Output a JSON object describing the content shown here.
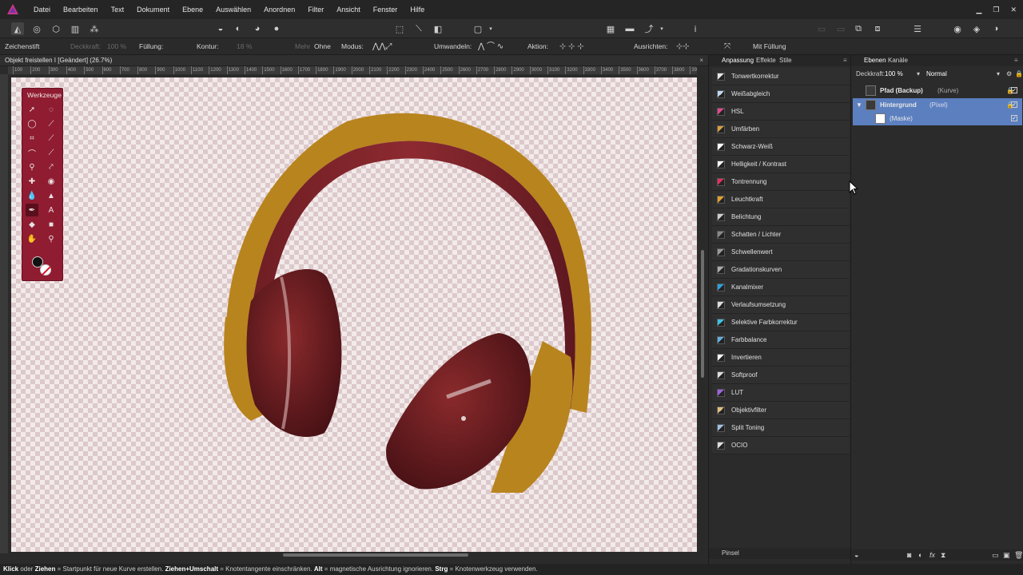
{
  "menubar": {
    "items": [
      "Datei",
      "Bearbeiten",
      "Text",
      "Dokument",
      "Ebene",
      "Auswählen",
      "Anordnen",
      "Filter",
      "Ansicht",
      "Fenster",
      "Hilfe"
    ],
    "brand_color": "#c23a8c"
  },
  "contextbar": {
    "tool_name": "Zeichenstift",
    "opacity_label": "Deckkraft:",
    "opacity_value": "100 %",
    "fill_label": "Füllung:",
    "stroke_label": "Kontur:",
    "stroke_width": "18 %",
    "more_label": "Mehr",
    "none_label": "Ohne",
    "mode_label": "Modus:",
    "convert_label": "Umwandeln:",
    "action_label": "Aktion:",
    "align_label": "Ausrichten:",
    "fill_check_label": "Mit Füllung"
  },
  "document": {
    "tab_title": "Objekt freistellen I [Geändert] (26.7%)",
    "close": "×"
  },
  "ruler": {
    "ticks": [
      "100",
      "200",
      "300",
      "400",
      "500",
      "600",
      "700",
      "800",
      "900",
      "1000",
      "1100",
      "1200",
      "1300",
      "1400",
      "1500",
      "1600",
      "1700",
      "1800",
      "1900",
      "2000",
      "2100",
      "2200",
      "2300",
      "2400",
      "2500",
      "2600",
      "2700",
      "2800",
      "2900",
      "3000",
      "3100",
      "3200",
      "3300",
      "3400",
      "3500",
      "3600",
      "3700",
      "3800",
      "3900"
    ]
  },
  "tools": {
    "title": "Werkzeuge",
    "accent_color": "#8f1c31"
  },
  "adjustments": {
    "tabs": [
      "Anpassung",
      "Effekte",
      "Stile"
    ],
    "items": [
      {
        "label": "Tonwertkorrektur",
        "icon": "levels-icon",
        "color": "#e8e8e8"
      },
      {
        "label": "Weißabgleich",
        "icon": "white-balance-icon",
        "color": "#c0d8f0"
      },
      {
        "label": "HSL",
        "icon": "hsl-icon",
        "color": "#e04a8a"
      },
      {
        "label": "Umfärben",
        "icon": "recolor-icon",
        "color": "#d8a040"
      },
      {
        "label": "Schwarz-Weiß",
        "icon": "black-white-icon",
        "color": "#ffffff"
      },
      {
        "label": "Helligkeit / Kontrast",
        "icon": "brightness-contrast-icon",
        "color": "#ffffff"
      },
      {
        "label": "Tontrennung",
        "icon": "posterize-icon",
        "color": "#e03060"
      },
      {
        "label": "Leuchtkraft",
        "icon": "vibrance-icon",
        "color": "#e0a030"
      },
      {
        "label": "Belichtung",
        "icon": "exposure-icon",
        "color": "#cccccc"
      },
      {
        "label": "Schatten / Lichter",
        "icon": "shadows-highlights-icon",
        "color": "#888888"
      },
      {
        "label": "Schwellenwert",
        "icon": "threshold-icon",
        "color": "#999999"
      },
      {
        "label": "Gradationskurven",
        "icon": "curves-icon",
        "color": "#aaaaaa"
      },
      {
        "label": "Kanalmixer",
        "icon": "channel-mixer-icon",
        "color": "#30a0e0"
      },
      {
        "label": "Verlaufsumsetzung",
        "icon": "gradient-map-icon",
        "color": "#dddddd"
      },
      {
        "label": "Selektive Farbkorrektur",
        "icon": "selective-color-icon",
        "color": "#40c0e0"
      },
      {
        "label": "Farbbalance",
        "icon": "color-balance-icon",
        "color": "#60b0e0"
      },
      {
        "label": "Invertieren",
        "icon": "invert-icon",
        "color": "#ffffff"
      },
      {
        "label": "Softproof",
        "icon": "soft-proof-icon",
        "color": "#dddddd"
      },
      {
        "label": "LUT",
        "icon": "lut-icon",
        "color": "#a060e0"
      },
      {
        "label": "Objektivfilter",
        "icon": "lens-filter-icon",
        "color": "#e0c080"
      },
      {
        "label": "Split Toning",
        "icon": "split-toning-icon",
        "color": "#a0c0e0"
      },
      {
        "label": "OCIO",
        "icon": "ocio-icon",
        "color": "#dddddd"
      }
    ],
    "search_label": "Pinsel"
  },
  "layers": {
    "tabs": [
      "Ebenen",
      "Kanäle"
    ],
    "opacity_label": "Deckkraft:",
    "opacity_value": "100 %",
    "blend_mode": "Normal",
    "rows": [
      {
        "name": "Pfad (Backup)",
        "type": "(Kurve)",
        "selected": false,
        "indent": 0
      },
      {
        "name": "Hintergrund",
        "type": "(Pixel)",
        "selected": true,
        "indent": 0
      },
      {
        "name": "(Maske)",
        "type": "",
        "selected": true,
        "indent": 1
      }
    ],
    "selection_color": "#5b7fbf"
  },
  "statusbar": {
    "k1": "Klick",
    "t1": " oder ",
    "k2": "Ziehen",
    "t2": " = Startpunkt für neue Kurve erstellen. ",
    "k3": "Ziehen+Umschalt",
    "t3": " = Knotentangente einschränken. ",
    "k4": "Alt",
    "t4": " = magnetische Ausrichtung ignorieren. ",
    "k5": "Strg",
    "t5": " = Knotenwerkzeug verwenden."
  }
}
